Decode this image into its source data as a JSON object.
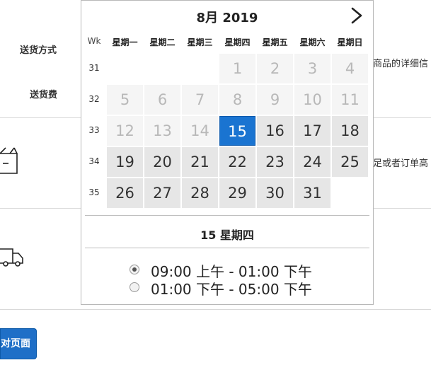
{
  "background": {
    "delivery_method_label": "送货方式",
    "delivery_fee_label": "送货费",
    "side_text_1": "商品的详细信",
    "side_text_2": "足或者订单高",
    "button_label": "对页面"
  },
  "calendar": {
    "month_title": "8月 2019",
    "week_header": "Wk",
    "weekdays": [
      "星期一",
      "星期二",
      "星期三",
      "星期四",
      "星期五",
      "星期六",
      "星期日"
    ],
    "weeks": [
      {
        "wk": "31",
        "days": [
          {
            "d": "",
            "t": "empty"
          },
          {
            "d": "",
            "t": "empty"
          },
          {
            "d": "",
            "t": "empty"
          },
          {
            "d": "1",
            "t": "other"
          },
          {
            "d": "2",
            "t": "other"
          },
          {
            "d": "3",
            "t": "other"
          },
          {
            "d": "4",
            "t": "other"
          }
        ]
      },
      {
        "wk": "32",
        "days": [
          {
            "d": "5",
            "t": "other"
          },
          {
            "d": "6",
            "t": "other"
          },
          {
            "d": "7",
            "t": "other"
          },
          {
            "d": "8",
            "t": "other"
          },
          {
            "d": "9",
            "t": "other"
          },
          {
            "d": "10",
            "t": "other"
          },
          {
            "d": "11",
            "t": "other"
          }
        ]
      },
      {
        "wk": "33",
        "days": [
          {
            "d": "12",
            "t": "other"
          },
          {
            "d": "13",
            "t": "other"
          },
          {
            "d": "14",
            "t": "other"
          },
          {
            "d": "15",
            "t": "sel"
          },
          {
            "d": "16",
            "t": "cur"
          },
          {
            "d": "17",
            "t": "cur"
          },
          {
            "d": "18",
            "t": "cur"
          }
        ]
      },
      {
        "wk": "34",
        "days": [
          {
            "d": "19",
            "t": "cur"
          },
          {
            "d": "20",
            "t": "cur"
          },
          {
            "d": "21",
            "t": "cur"
          },
          {
            "d": "22",
            "t": "cur"
          },
          {
            "d": "23",
            "t": "cur"
          },
          {
            "d": "24",
            "t": "cur"
          },
          {
            "d": "25",
            "t": "cur"
          }
        ]
      },
      {
        "wk": "35",
        "days": [
          {
            "d": "26",
            "t": "cur"
          },
          {
            "d": "27",
            "t": "cur"
          },
          {
            "d": "28",
            "t": "cur"
          },
          {
            "d": "29",
            "t": "cur"
          },
          {
            "d": "30",
            "t": "cur"
          },
          {
            "d": "31",
            "t": "cur"
          },
          {
            "d": "",
            "t": "empty"
          }
        ]
      }
    ],
    "selected_date_label": "15 星期四",
    "time_slots": [
      {
        "label": "09:00 上午 - 01:00 下午",
        "checked": true
      },
      {
        "label": "01:00 下午 - 05:00 下午",
        "checked": false
      }
    ],
    "colors": {
      "selected": "#1a74d1",
      "available": "#e6e6e6",
      "disabled": "#f5f5f5"
    }
  }
}
